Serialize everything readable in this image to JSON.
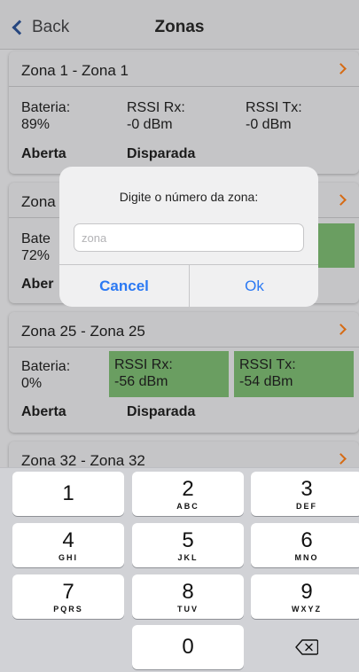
{
  "nav": {
    "back_label": "Back",
    "title": "Zonas"
  },
  "cards": [
    {
      "title": "Zona 1 - Zona 1",
      "bateria": {
        "label": "Bateria:",
        "value": "89%"
      },
      "rssi_rx": {
        "label": "RSSI Rx:",
        "value": "-0 dBm"
      },
      "rssi_tx": {
        "label": "RSSI Tx:",
        "value": "-0 dBm"
      },
      "status_left": "Aberta",
      "status_right": "Disparada"
    },
    {
      "title_partial": "Zona",
      "bateria": {
        "label_partial": "Bate",
        "value_partial": "72%"
      },
      "status_left_partial": "Aber"
    },
    {
      "title": "Zona 25 - Zona 25",
      "bateria": {
        "label": "Bateria:",
        "value": "0%"
      },
      "rssi_rx": {
        "label": "RSSI Rx:",
        "value": "-56 dBm"
      },
      "rssi_tx": {
        "label": "RSSI Tx:",
        "value": "-54 dBm"
      },
      "status_left": "Aberta",
      "status_right": "Disparada"
    },
    {
      "title": "Zona 32 - Zona 32"
    }
  ],
  "dialog": {
    "message": "Digite o número da zona:",
    "input_placeholder": "zona",
    "input_value": "",
    "cancel_label": "Cancel",
    "ok_label": "Ok"
  },
  "keypad": {
    "keys": [
      {
        "digit": "1",
        "letters": ""
      },
      {
        "digit": "2",
        "letters": "ABC"
      },
      {
        "digit": "3",
        "letters": "DEF"
      },
      {
        "digit": "4",
        "letters": "GHI"
      },
      {
        "digit": "5",
        "letters": "JKL"
      },
      {
        "digit": "6",
        "letters": "MNO"
      },
      {
        "digit": "7",
        "letters": "PQRS"
      },
      {
        "digit": "8",
        "letters": "TUV"
      },
      {
        "digit": "9",
        "letters": "WXYZ"
      },
      {
        "digit": "0",
        "letters": ""
      }
    ],
    "delete_icon": "backspace-icon"
  },
  "colors": {
    "accent_blue": "#2b79f3",
    "chevron_orange": "#d66a12",
    "rssi_green": "#6a9e61"
  }
}
